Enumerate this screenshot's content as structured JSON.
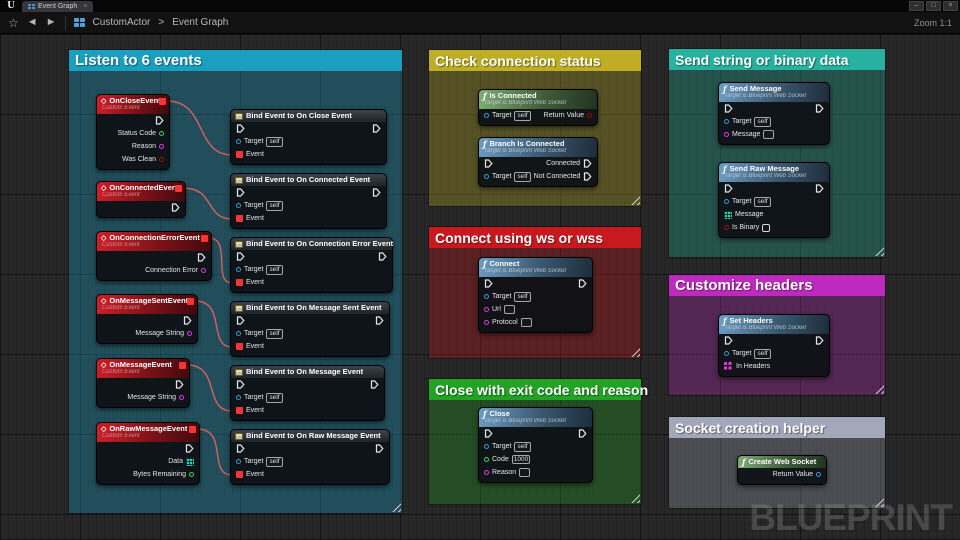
{
  "titlebar": {
    "tab_label": "Event Graph",
    "tab_close": "×",
    "window_minimize": "–",
    "window_maximize": "□",
    "window_close": "×",
    "logo": "U"
  },
  "toolbar": {
    "star": "☆",
    "back": "◄",
    "forward": "►",
    "breadcrumb_root": "CustomActor",
    "breadcrumb_sep": ">",
    "breadcrumb_current": "Event Graph",
    "zoom_label": "Zoom 1:1"
  },
  "watermark": "BLUEPRINT",
  "shared": {
    "custom_event_subtitle": "Custom Event",
    "ws_subtitle": "Target is Blueprint Web Socket",
    "fn_icon": "ƒ",
    "ce_icon": "◇",
    "target_label": "Target",
    "self_value": "self",
    "event_label": "Event",
    "return_value_label": "Return Value"
  },
  "comments": {
    "listen": {
      "title": "Listen to 6 events"
    },
    "check": {
      "title": "Check connection status"
    },
    "connect": {
      "title": "Connect using ws or wss"
    },
    "close": {
      "title": "Close with exit code and reason"
    },
    "send": {
      "title": "Send string or binary data"
    },
    "headers": {
      "title": "Customize headers"
    },
    "helper": {
      "title": "Socket creation helper"
    }
  },
  "events": [
    {
      "title": "OnCloseEvent",
      "pin1": "Status Code",
      "pin2": "Reason",
      "pin3": "Was Clean"
    },
    {
      "title": "OnConnectedEvent"
    },
    {
      "title": "OnConnectionErrorEvent",
      "pin1": "Connection Error"
    },
    {
      "title": "OnMessageSentEvent",
      "pin1": "Message String"
    },
    {
      "title": "OnMessageEvent",
      "pin1": "Message String"
    },
    {
      "title": "OnRawMessageEvent",
      "pin1": "Data",
      "pin2": "Bytes Remaining"
    }
  ],
  "binds": [
    "Bind Event to On Close Event",
    "Bind Event to On Connected Event",
    "Bind Event to On Connection Error Event",
    "Bind Event to On Message Sent Event",
    "Bind Event to On Message Event",
    "Bind Event to On Raw Message Event"
  ],
  "functions": {
    "is_connected": {
      "title": "Is Connected"
    },
    "branch": {
      "title": "Branch Is Connected",
      "out_true": "Connected",
      "out_false": "Not Connected"
    },
    "connect": {
      "title": "Connect",
      "url_label": "Url",
      "protocol_label": "Protocol"
    },
    "close": {
      "title": "Close",
      "code_label": "Code",
      "code_value": "1000",
      "reason_label": "Reason"
    },
    "send_message": {
      "title": "Send Message",
      "message_label": "Message"
    },
    "send_raw": {
      "title": "Send Raw Message",
      "message_label": "Message",
      "is_binary_label": "Is Binary"
    },
    "set_headers": {
      "title": "Set Headers",
      "in_headers_label": "In Headers"
    },
    "create_socket": {
      "title": "Create Web Socket"
    }
  }
}
